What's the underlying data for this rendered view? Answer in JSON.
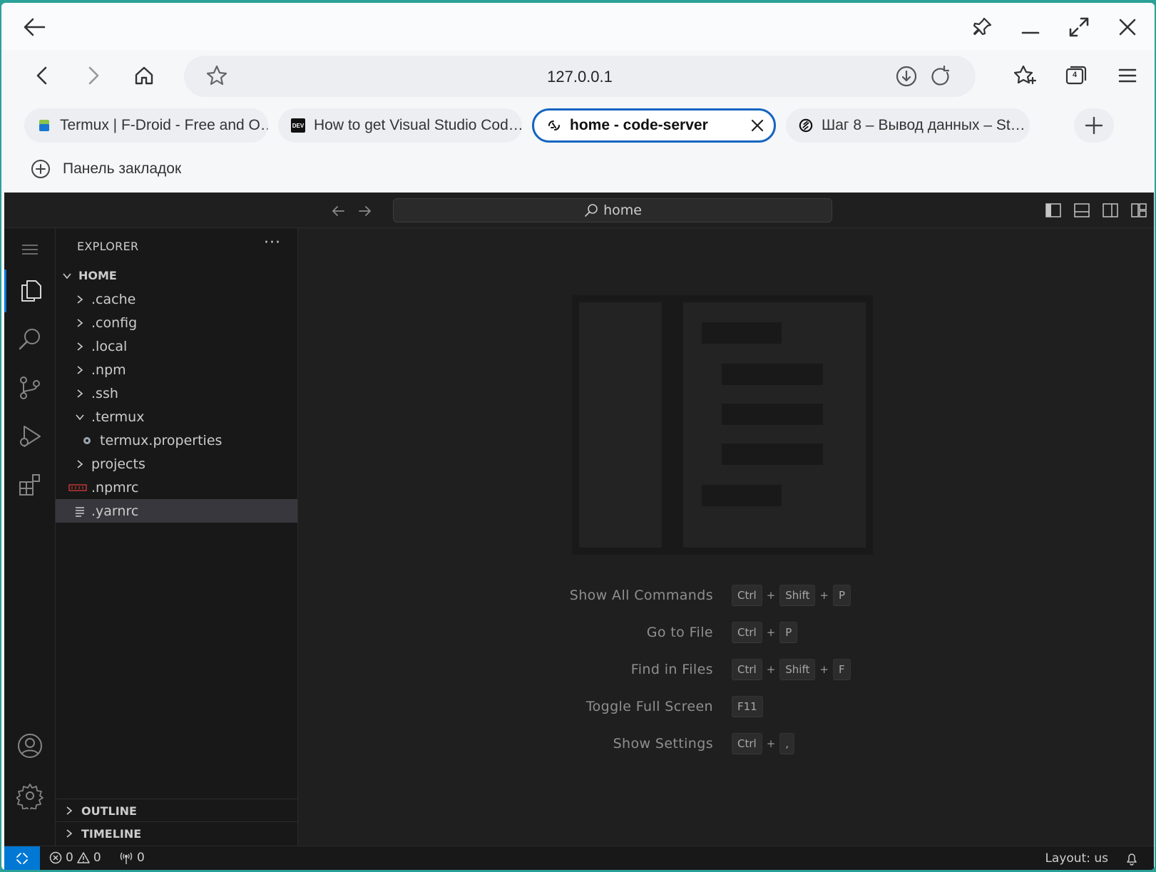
{
  "browser": {
    "url": "127.0.0.1",
    "tab_count": "4",
    "tabs": [
      {
        "title": "Termux | F-Droid - Free and O…"
      },
      {
        "title": "How to get Visual Studio Cod…",
        "favicon_text": "DEV"
      },
      {
        "title": "home - code-server"
      },
      {
        "title": "Шаг 8 – Вывод данных – St…"
      }
    ],
    "bookmarks_bar": "Панель закладок"
  },
  "vscode": {
    "search": "home",
    "explorer": {
      "title": "EXPLORER",
      "more": "···",
      "root": "HOME",
      "items": [
        {
          "label": ".cache"
        },
        {
          "label": ".config"
        },
        {
          "label": ".local"
        },
        {
          "label": ".npm"
        },
        {
          "label": ".ssh"
        },
        {
          "label": ".termux"
        },
        {
          "label": "termux.properties"
        },
        {
          "label": "projects"
        },
        {
          "label": ".npmrc"
        },
        {
          "label": ".yarnrc"
        }
      ],
      "outline": "OUTLINE",
      "timeline": "TIMELINE"
    },
    "shortcuts": [
      {
        "label": "Show All Commands",
        "keys": [
          "Ctrl",
          "Shift",
          "P"
        ]
      },
      {
        "label": "Go to File",
        "keys": [
          "Ctrl",
          "P"
        ]
      },
      {
        "label": "Find in Files",
        "keys": [
          "Ctrl",
          "Shift",
          "F"
        ]
      },
      {
        "label": "Toggle Full Screen",
        "keys": [
          "F11"
        ]
      },
      {
        "label": "Show Settings",
        "keys": [
          "Ctrl",
          ","
        ]
      }
    ],
    "plus": "+",
    "status": {
      "errors": "0",
      "warnings": "0",
      "ports": "0",
      "layout": "Layout: us"
    }
  }
}
